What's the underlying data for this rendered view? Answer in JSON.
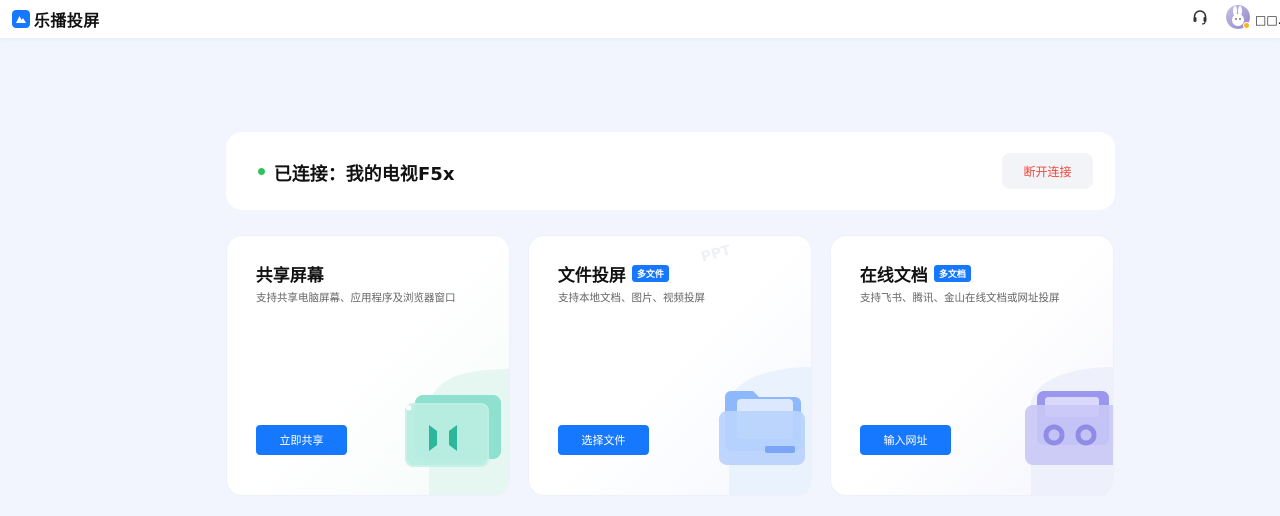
{
  "header": {
    "brand_name": "乐播投屏",
    "username": "□□.开"
  },
  "icons": {
    "logo": "lebo-logo-icon",
    "support": "headset-icon",
    "avatar": "bunny-avatar",
    "share": "split-screen-icon",
    "file": "folder-icon",
    "online": "link-loop-icon"
  },
  "status": {
    "text": "已连接：我的电视F5x",
    "disconnect_label": "断开连接",
    "connected_color": "#2fc25b"
  },
  "cards": [
    {
      "title": "共享屏幕",
      "badge": "",
      "description": "支持共享电脑屏幕、应用程序及浏览器窗口",
      "button_label": "立即共享"
    },
    {
      "title": "文件投屏",
      "badge": "多文件",
      "description": "支持本地文档、图片、视频投屏",
      "button_label": "选择文件"
    },
    {
      "title": "在线文档",
      "badge": "多文档",
      "description": "支持飞书、腾讯、金山在线文档或网址投屏",
      "button_label": "输入网址"
    }
  ],
  "colors": {
    "accent": "#1677ff",
    "danger": "#f5483b",
    "page_bg": "#f2f5fd"
  }
}
